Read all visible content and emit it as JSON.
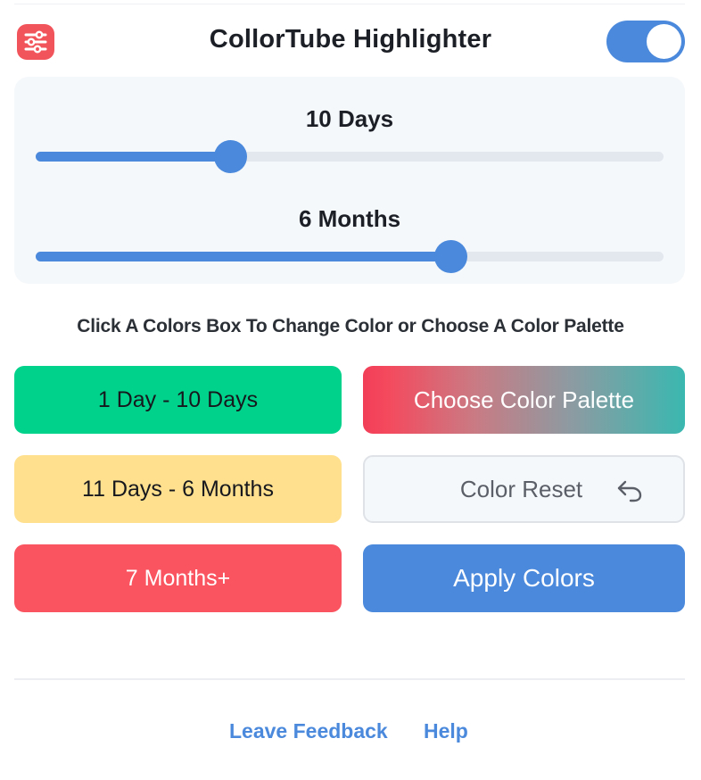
{
  "header": {
    "title": "CollorTube Highlighter",
    "app_icon": "sliders-icon",
    "toggle_on": true
  },
  "sliders": [
    {
      "label": "10 Days",
      "fill_fraction": 0.31
    },
    {
      "label": "6 Months",
      "fill_fraction": 0.66
    }
  ],
  "instruction": "Click A Colors Box To Change Color or Choose A Color Palette",
  "color_buttons": {
    "range1": "1 Day - 10 Days",
    "range2": "11 Days - 6 Months",
    "range3": "7 Months+"
  },
  "actions": {
    "palette": "Choose Color Palette",
    "reset": "Color Reset",
    "reset_icon": "undo-icon",
    "apply": "Apply Colors"
  },
  "footer": {
    "feedback": "Leave Feedback",
    "help": "Help"
  },
  "colors": {
    "accent": "#4a89dc",
    "range1": "#00d18b",
    "range2": "#ffe08f",
    "range3": "#f9545f",
    "icon_bg": "#f2545b"
  }
}
